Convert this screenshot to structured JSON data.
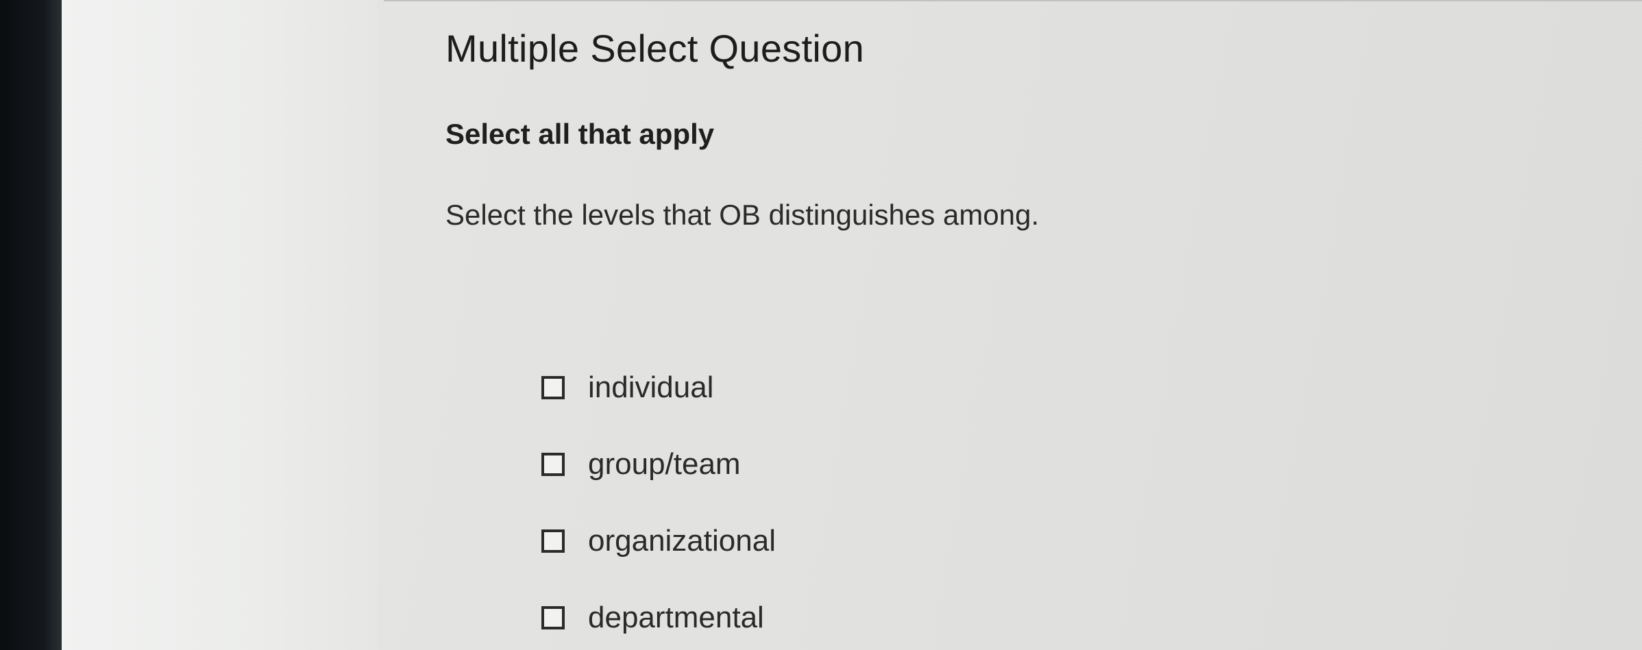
{
  "question": {
    "title": "Multiple Select Question",
    "instruction": "Select all that apply",
    "prompt": "Select the levels that OB distinguishes among."
  },
  "options": [
    {
      "label": "individual",
      "checked": false
    },
    {
      "label": "group/team",
      "checked": false
    },
    {
      "label": "organizational",
      "checked": false
    },
    {
      "label": "departmental",
      "checked": false
    }
  ],
  "colors": {
    "text": "#1d1d1d",
    "background": "#e1e1df",
    "bezel": "#0b0d10"
  }
}
